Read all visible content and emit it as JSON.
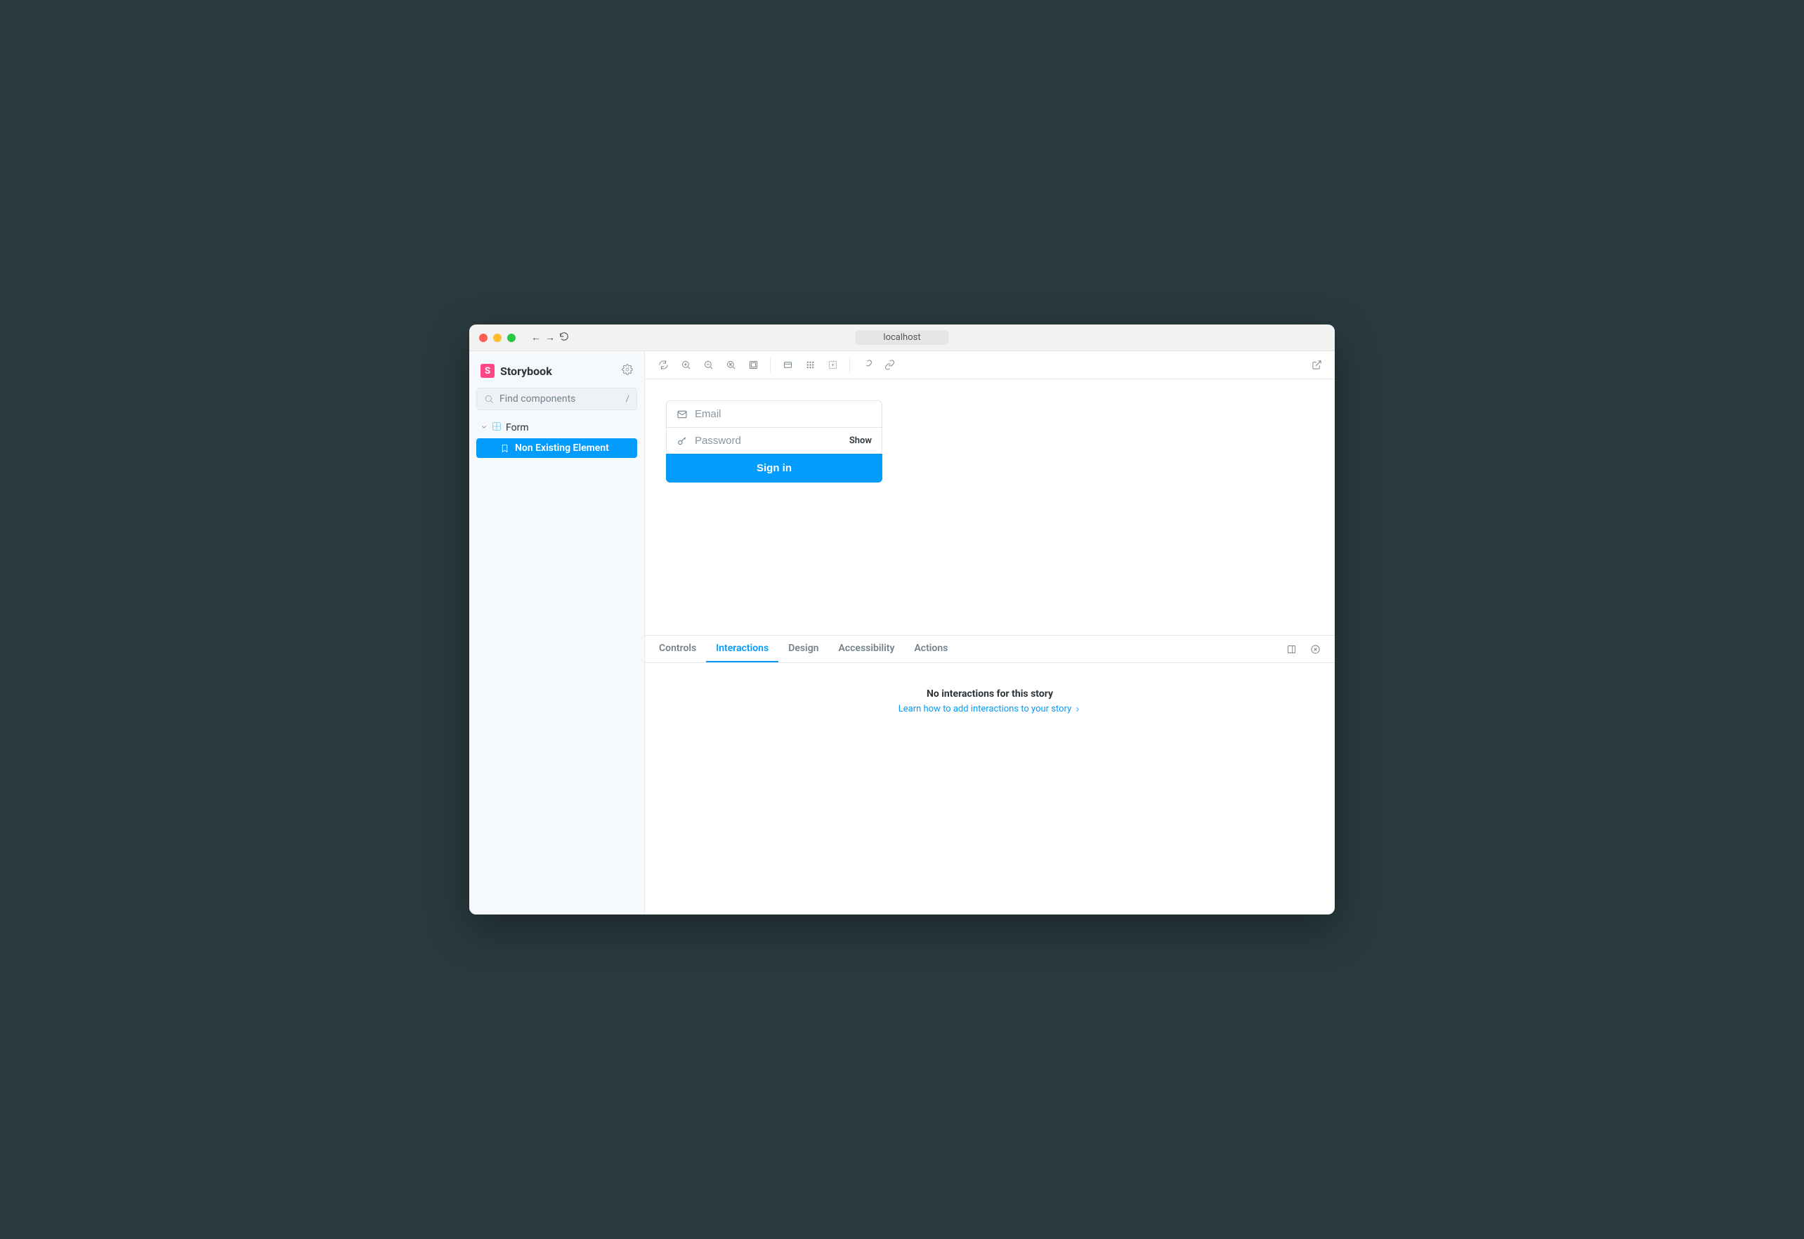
{
  "browser": {
    "url": "localhost"
  },
  "sidebar": {
    "brand": "Storybook",
    "search_placeholder": "Find components",
    "search_kbd": "/",
    "group_label": "Form",
    "story_label": "Non Existing Element"
  },
  "canvas": {
    "email_placeholder": "Email",
    "password_placeholder": "Password",
    "show_label": "Show",
    "signin_label": "Sign in"
  },
  "addons": {
    "tabs": {
      "controls": "Controls",
      "interactions": "Interactions",
      "design": "Design",
      "accessibility": "Accessibility",
      "actions": "Actions"
    },
    "empty_title": "No interactions for this story",
    "empty_link": "Learn how to add interactions to your story"
  }
}
